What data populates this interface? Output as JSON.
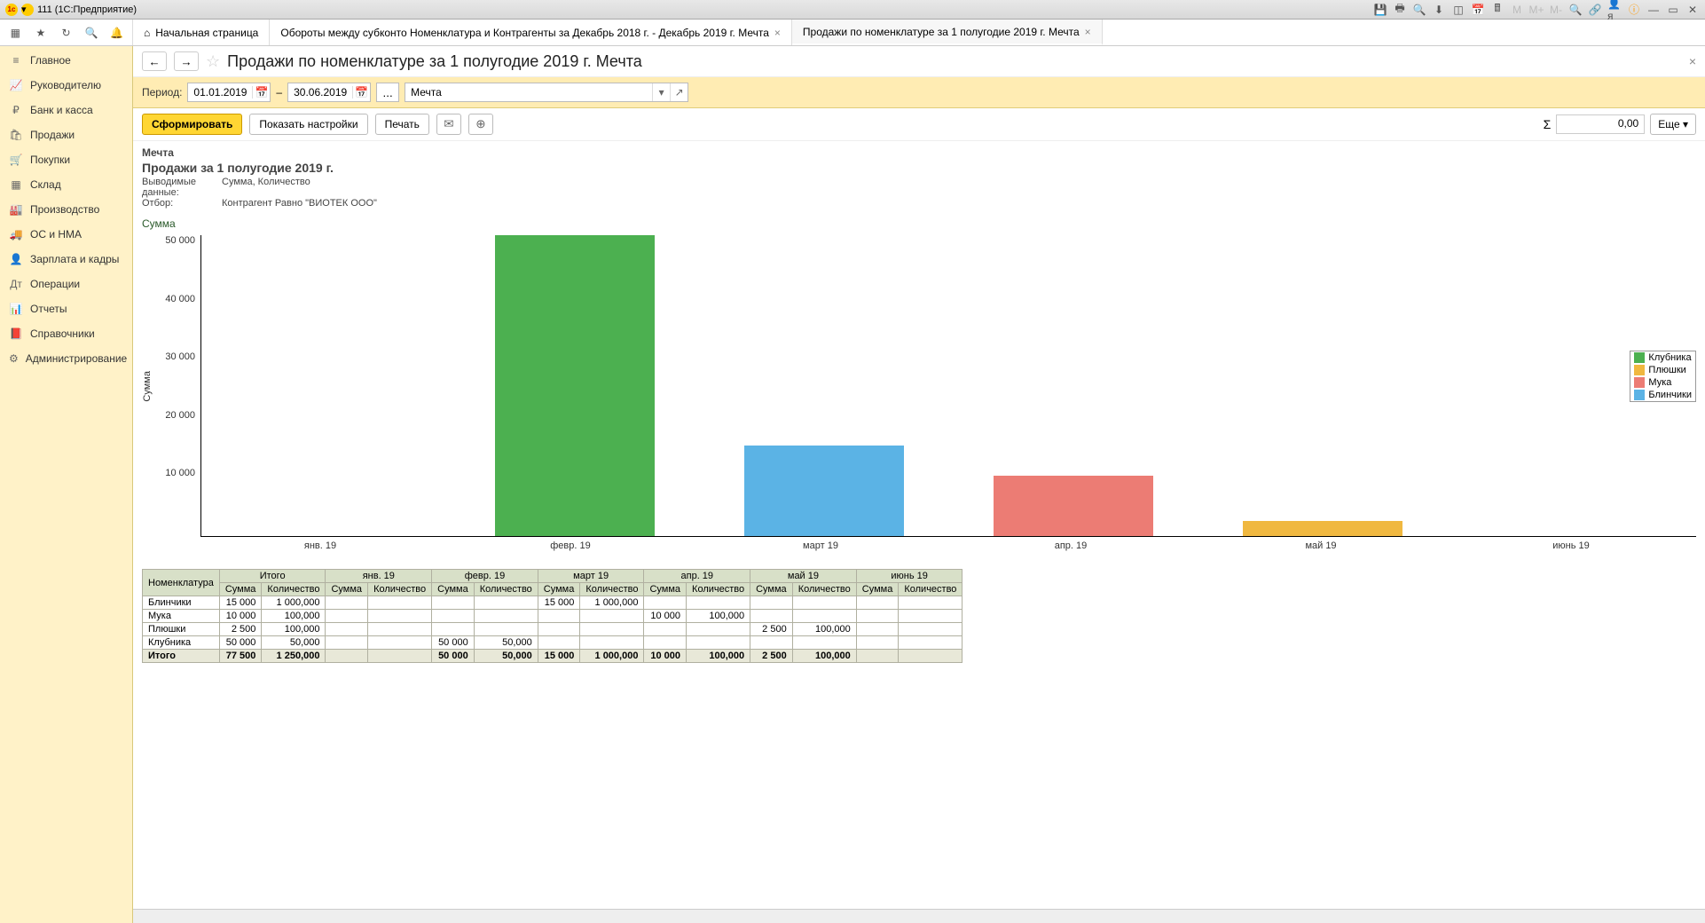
{
  "titlebar": {
    "app": "111  (1С:Предприятие)"
  },
  "tabs": {
    "home": "Начальная страница",
    "t1": "Обороты между субконто Номенклатура и Контрагенты за Декабрь 2018 г. - Декабрь 2019 г. Мечта",
    "t2": "Продажи по номенклатуре за 1 полугодие 2019 г. Мечта"
  },
  "sidebar": {
    "items": [
      {
        "label": "Главное",
        "icon": "≡"
      },
      {
        "label": "Руководителю",
        "icon": "📈"
      },
      {
        "label": "Банк и касса",
        "icon": "₽"
      },
      {
        "label": "Продажи",
        "icon": "🛍"
      },
      {
        "label": "Покупки",
        "icon": "🛒"
      },
      {
        "label": "Склад",
        "icon": "▦"
      },
      {
        "label": "Производство",
        "icon": "🏭"
      },
      {
        "label": "ОС и НМА",
        "icon": "🚚"
      },
      {
        "label": "Зарплата и кадры",
        "icon": "👤"
      },
      {
        "label": "Операции",
        "icon": "Дт"
      },
      {
        "label": "Отчеты",
        "icon": "📊"
      },
      {
        "label": "Справочники",
        "icon": "📕"
      },
      {
        "label": "Администрирование",
        "icon": "⚙"
      }
    ]
  },
  "page": {
    "title": "Продажи по номенклатуре за 1 полугодие 2019 г. Мечта",
    "period_label": "Период:",
    "date_from": "01.01.2019",
    "date_to": "30.06.2019",
    "org": "Мечта",
    "btn_generate": "Сформировать",
    "btn_settings": "Показать настройки",
    "btn_print": "Печать",
    "sum_sign": "Σ",
    "sum_value": "0,00",
    "btn_more": "Еще"
  },
  "report": {
    "org": "Мечта",
    "title": "Продажи за 1 полугодие 2019 г.",
    "out_label": "Выводимые данные:",
    "out_value": "Сумма, Количество",
    "filter_label": "Отбор:",
    "filter_value": "Контрагент Равно \"ВИОТЕК ООО\""
  },
  "chart_data": {
    "type": "bar",
    "title": "Сумма",
    "ylabel": "Сумма",
    "ylim": [
      0,
      50000
    ],
    "yticks": [
      "50 000",
      "40 000",
      "30 000",
      "20 000",
      "10 000"
    ],
    "categories": [
      "янв. 19",
      "февр. 19",
      "март 19",
      "апр. 19",
      "май 19",
      "июнь 19"
    ],
    "series": [
      {
        "name": "Клубника",
        "color": "#4cb050",
        "values": [
          0,
          50000,
          0,
          0,
          0,
          0
        ]
      },
      {
        "name": "Плюшки",
        "color": "#f0b840",
        "values": [
          0,
          0,
          0,
          0,
          2500,
          0
        ]
      },
      {
        "name": "Мука",
        "color": "#ec7c74",
        "values": [
          0,
          0,
          0,
          10000,
          0,
          0
        ]
      },
      {
        "name": "Блинчики",
        "color": "#5bb3e5",
        "values": [
          0,
          0,
          15000,
          0,
          0,
          0
        ]
      }
    ]
  },
  "table": {
    "headers": {
      "nomen": "Номенклатура",
      "total": "Итого",
      "sum": "Сумма",
      "qty": "Количество",
      "months": [
        "янв. 19",
        "февр. 19",
        "март 19",
        "апр. 19",
        "май 19",
        "июнь 19"
      ]
    },
    "rows": [
      {
        "name": "Блинчики",
        "total_sum": "15 000",
        "total_qty": "1 000,000",
        "cells": [
          [
            "",
            ""
          ],
          [
            "",
            ""
          ],
          [
            "15 000",
            "1 000,000"
          ],
          [
            "",
            ""
          ],
          [
            "",
            ""
          ],
          [
            "",
            ""
          ]
        ]
      },
      {
        "name": "Мука",
        "total_sum": "10 000",
        "total_qty": "100,000",
        "cells": [
          [
            "",
            ""
          ],
          [
            "",
            ""
          ],
          [
            "",
            ""
          ],
          [
            "10 000",
            "100,000"
          ],
          [
            "",
            ""
          ],
          [
            "",
            ""
          ]
        ]
      },
      {
        "name": "Плюшки",
        "total_sum": "2 500",
        "total_qty": "100,000",
        "cells": [
          [
            "",
            ""
          ],
          [
            "",
            ""
          ],
          [
            "",
            ""
          ],
          [
            "",
            ""
          ],
          [
            "2 500",
            "100,000"
          ],
          [
            "",
            ""
          ]
        ]
      },
      {
        "name": "Клубника",
        "total_sum": "50 000",
        "total_qty": "50,000",
        "cells": [
          [
            "",
            ""
          ],
          [
            "50 000",
            "50,000"
          ],
          [
            "",
            ""
          ],
          [
            "",
            ""
          ],
          [
            "",
            ""
          ],
          [
            "",
            ""
          ]
        ]
      }
    ],
    "total_row": {
      "name": "Итого",
      "total_sum": "77 500",
      "total_qty": "1 250,000",
      "cells": [
        [
          "",
          ""
        ],
        [
          "50 000",
          "50,000"
        ],
        [
          "15 000",
          "1 000,000"
        ],
        [
          "10 000",
          "100,000"
        ],
        [
          "2 500",
          "100,000"
        ],
        [
          "",
          ""
        ]
      ]
    }
  }
}
